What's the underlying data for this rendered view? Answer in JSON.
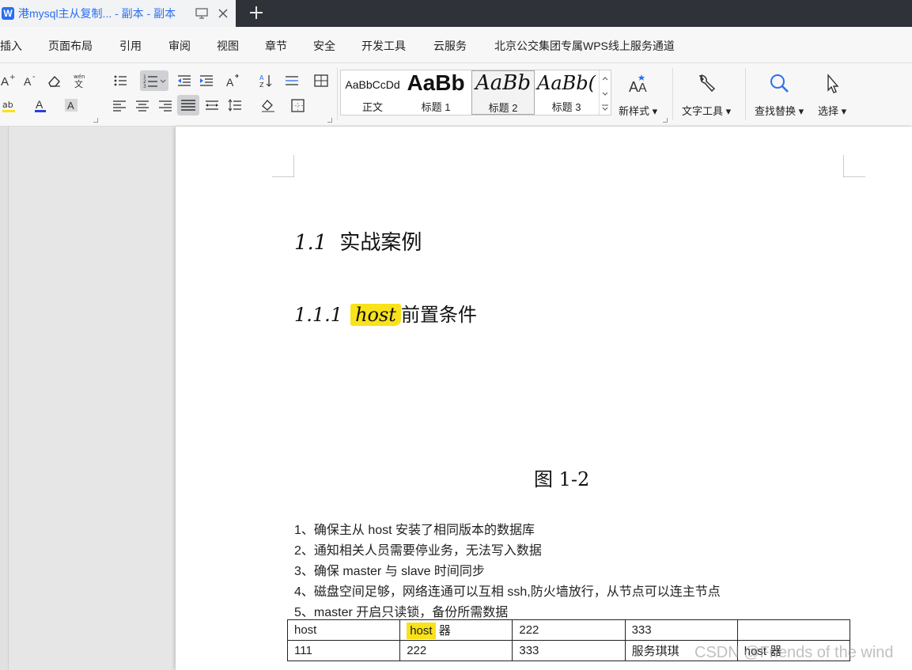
{
  "tab": {
    "logo": "W",
    "title": "港mysql主从复制... - 副本 - 副本",
    "close_icon": "close-icon",
    "new_tab_icon": "plus-icon"
  },
  "menu": {
    "items": [
      "插入",
      "页面布局",
      "引用",
      "审阅",
      "视图",
      "章节",
      "安全",
      "开发工具",
      "云服务",
      "北京公交集团专属WPS线上服务通道"
    ]
  },
  "styles": {
    "items": [
      {
        "preview": "AaBbCcDd",
        "label": "正文"
      },
      {
        "preview": "AaBb",
        "label": "标题 1"
      },
      {
        "preview": "AaBb",
        "label": "标题 2"
      },
      {
        "preview": "AaBb(",
        "label": "标题 3"
      }
    ],
    "selected_index": 2
  },
  "tools": {
    "new_style": "新样式",
    "text_tool": "文字工具",
    "find_replace": "查找替换",
    "select": "选择"
  },
  "document": {
    "heading1": {
      "number": "1.1",
      "text": "实战案例"
    },
    "heading2": {
      "number": "1.1.1",
      "highlight": "host",
      "text": "前置条件"
    },
    "caption": "图 1-2",
    "paragraphs": [
      "1、确保主从 host 安装了相同版本的数据库",
      "2、通知相关人员需要停业务，无法写入数据",
      "3、确保 master 与 slave 时间同步",
      "4、磁盘空间足够，网络连通可以互相 ssh,防火墙放行，从节点可以连主节点",
      "5、master 开启只读锁，备份所需数据"
    ],
    "table": {
      "row1": {
        "c1": "host",
        "c2_highlight": "host",
        "c2_rest": " 器",
        "c3": "222",
        "c4": "333",
        "c5": ""
      },
      "row2": {
        "c1": "111",
        "c2": "222",
        "c3": "333",
        "c4": "服务琪琪",
        "c5": "host 器"
      }
    },
    "highlight_color": "#f9e21a"
  },
  "watermark": "CSDN @Friends of the wind"
}
